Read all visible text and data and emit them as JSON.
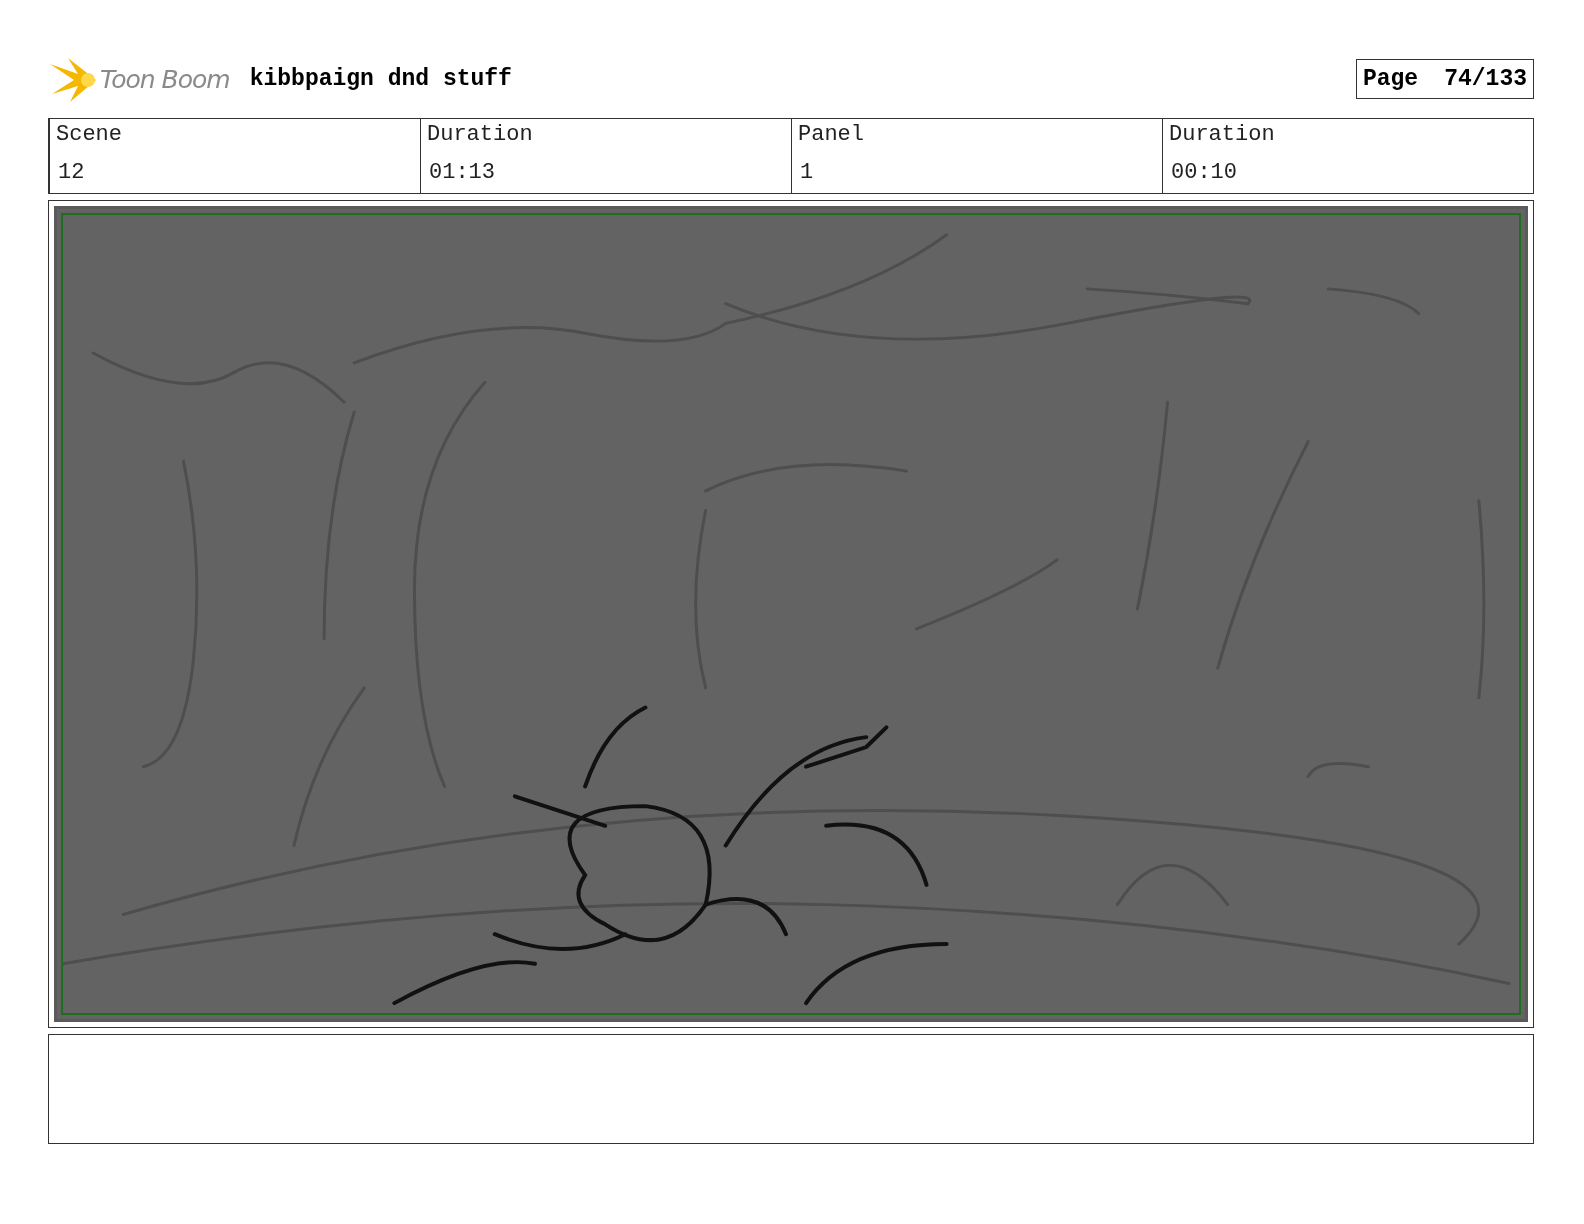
{
  "header": {
    "logo_text": "Toon Boom",
    "project_title": "kibbpaign dnd stuff",
    "page_label": "Page",
    "page_number": "74/133"
  },
  "info_cells": [
    {
      "label": "Scene",
      "value": "12"
    },
    {
      "label": "Duration",
      "value": "01:13"
    },
    {
      "label": "Panel",
      "value": "1"
    },
    {
      "label": "Duration",
      "value": "00:10"
    }
  ],
  "panel": {
    "kind": "sketch"
  }
}
